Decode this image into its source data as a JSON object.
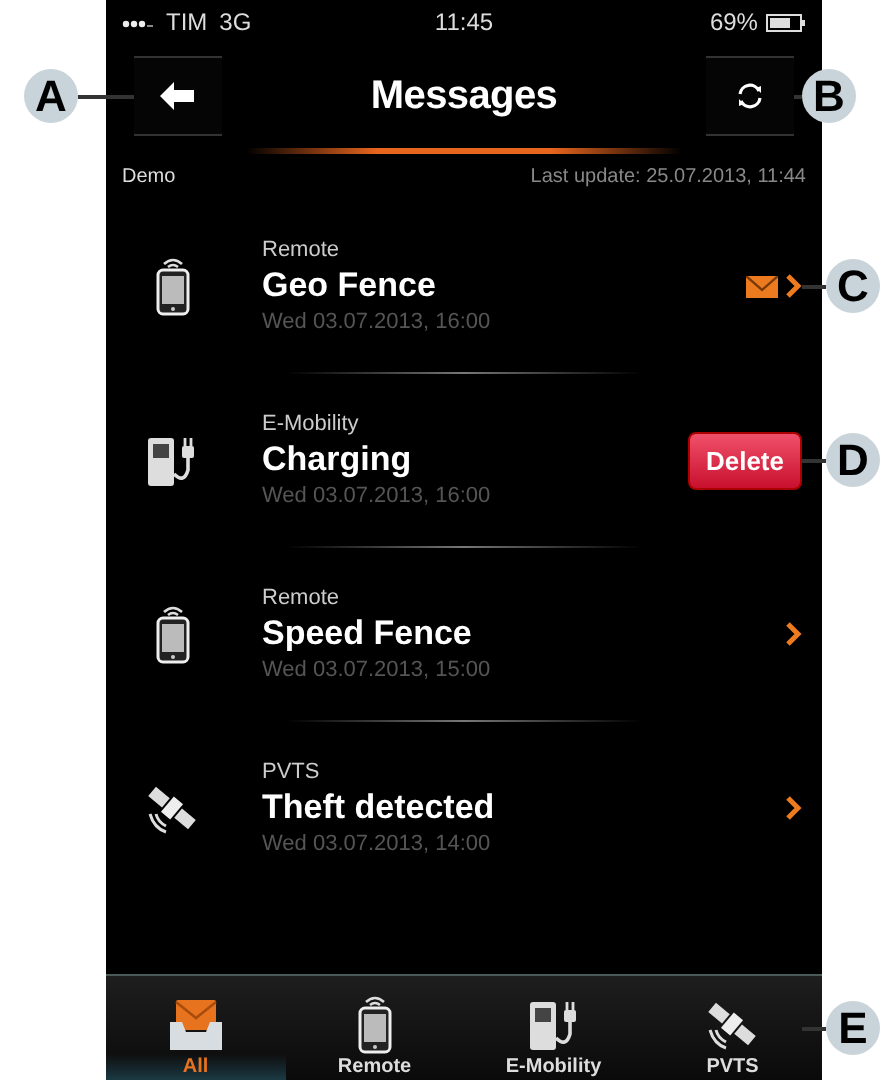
{
  "status_bar": {
    "carrier": "TIM",
    "network": "3G",
    "time": "11:45",
    "battery": "69%"
  },
  "header": {
    "title": "Messages",
    "back_callout": "A",
    "refresh_callout": "B"
  },
  "subheader": {
    "account": "Demo",
    "last_update": "Last update: 25.07.2013, 11:44"
  },
  "messages": [
    {
      "kind": "phone",
      "category": "Remote",
      "title": "Geo Fence",
      "date": "Wed 03.07.2013, 16:00",
      "unread": true,
      "delete_shown": false,
      "callout": "C"
    },
    {
      "kind": "charger",
      "category": "E-Mobility",
      "title": "Charging",
      "date": "Wed 03.07.2013, 16:00",
      "unread": false,
      "delete_shown": true,
      "delete_label": "Delete",
      "callout": "D"
    },
    {
      "kind": "phone",
      "category": "Remote",
      "title": "Speed Fence",
      "date": "Wed 03.07.2013, 15:00",
      "unread": false,
      "delete_shown": false
    },
    {
      "kind": "satellite",
      "category": "PVTS",
      "title": "Theft detected",
      "date": "Wed 03.07.2013, 14:00",
      "unread": false,
      "delete_shown": false
    }
  ],
  "tab_bar": {
    "callout": "E",
    "tabs": [
      {
        "kind": "inbox",
        "label": "All",
        "selected": true
      },
      {
        "kind": "phone",
        "label": "Remote",
        "selected": false
      },
      {
        "kind": "charger",
        "label": "E-Mobility",
        "selected": false
      },
      {
        "kind": "satellite",
        "label": "PVTS",
        "selected": false
      }
    ]
  }
}
